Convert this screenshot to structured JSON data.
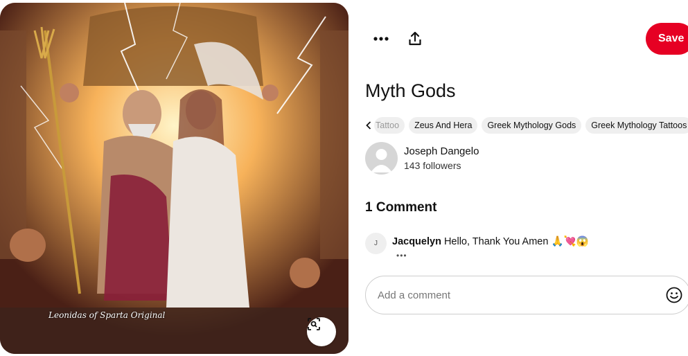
{
  "pin": {
    "image_alt": "Zeus and Hera on throne surrounded by lightning and winged figures",
    "watermark": "Leonidas of Sparta Original",
    "title": "Myth Gods"
  },
  "toolbar": {
    "more_icon": "more-options-icon",
    "share_icon": "share-icon",
    "save_label": "Save"
  },
  "tags": [
    {
      "label": "Tattoo"
    },
    {
      "label": "Zeus And Hera"
    },
    {
      "label": "Greek Mythology Gods"
    },
    {
      "label": "Greek Mythology Tattoos"
    }
  ],
  "creator": {
    "name": "Joseph Dangelo",
    "followers": "143 followers"
  },
  "comments": {
    "heading": "1 Comment",
    "items": [
      {
        "initial": "J",
        "author": "Jacquelyn",
        "text": "Hello, Thank You Amen 🙏💘😱",
        "more": "•••"
      }
    ]
  },
  "comment_input": {
    "placeholder": "Add a comment"
  },
  "colors": {
    "save_button": "#e60023",
    "tag_background": "#efefef"
  }
}
